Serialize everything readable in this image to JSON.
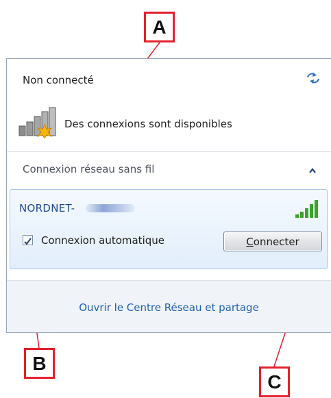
{
  "panel": {
    "status_title": "Non connecté",
    "refresh_icon": "refresh-icon",
    "available_text": "Des connexions sont disponibles",
    "section_header": "Connexion réseau sans fil",
    "collapse_icon": "chevron-up-icon",
    "network": {
      "ssid": "NORDNET-",
      "signal_level": "5 of 5 bars",
      "auto_connect_label": "Connexion automatique",
      "auto_connect_checked": true,
      "connect_label": "Connecter"
    },
    "footer_link": "Ouvrir le Centre Réseau et partage"
  },
  "callouts": {
    "a": "A",
    "b": "B",
    "c": "C"
  },
  "colors": {
    "callout_border": "#e4202c",
    "link": "#1f5fae",
    "signal_green": "#3aa52a"
  }
}
